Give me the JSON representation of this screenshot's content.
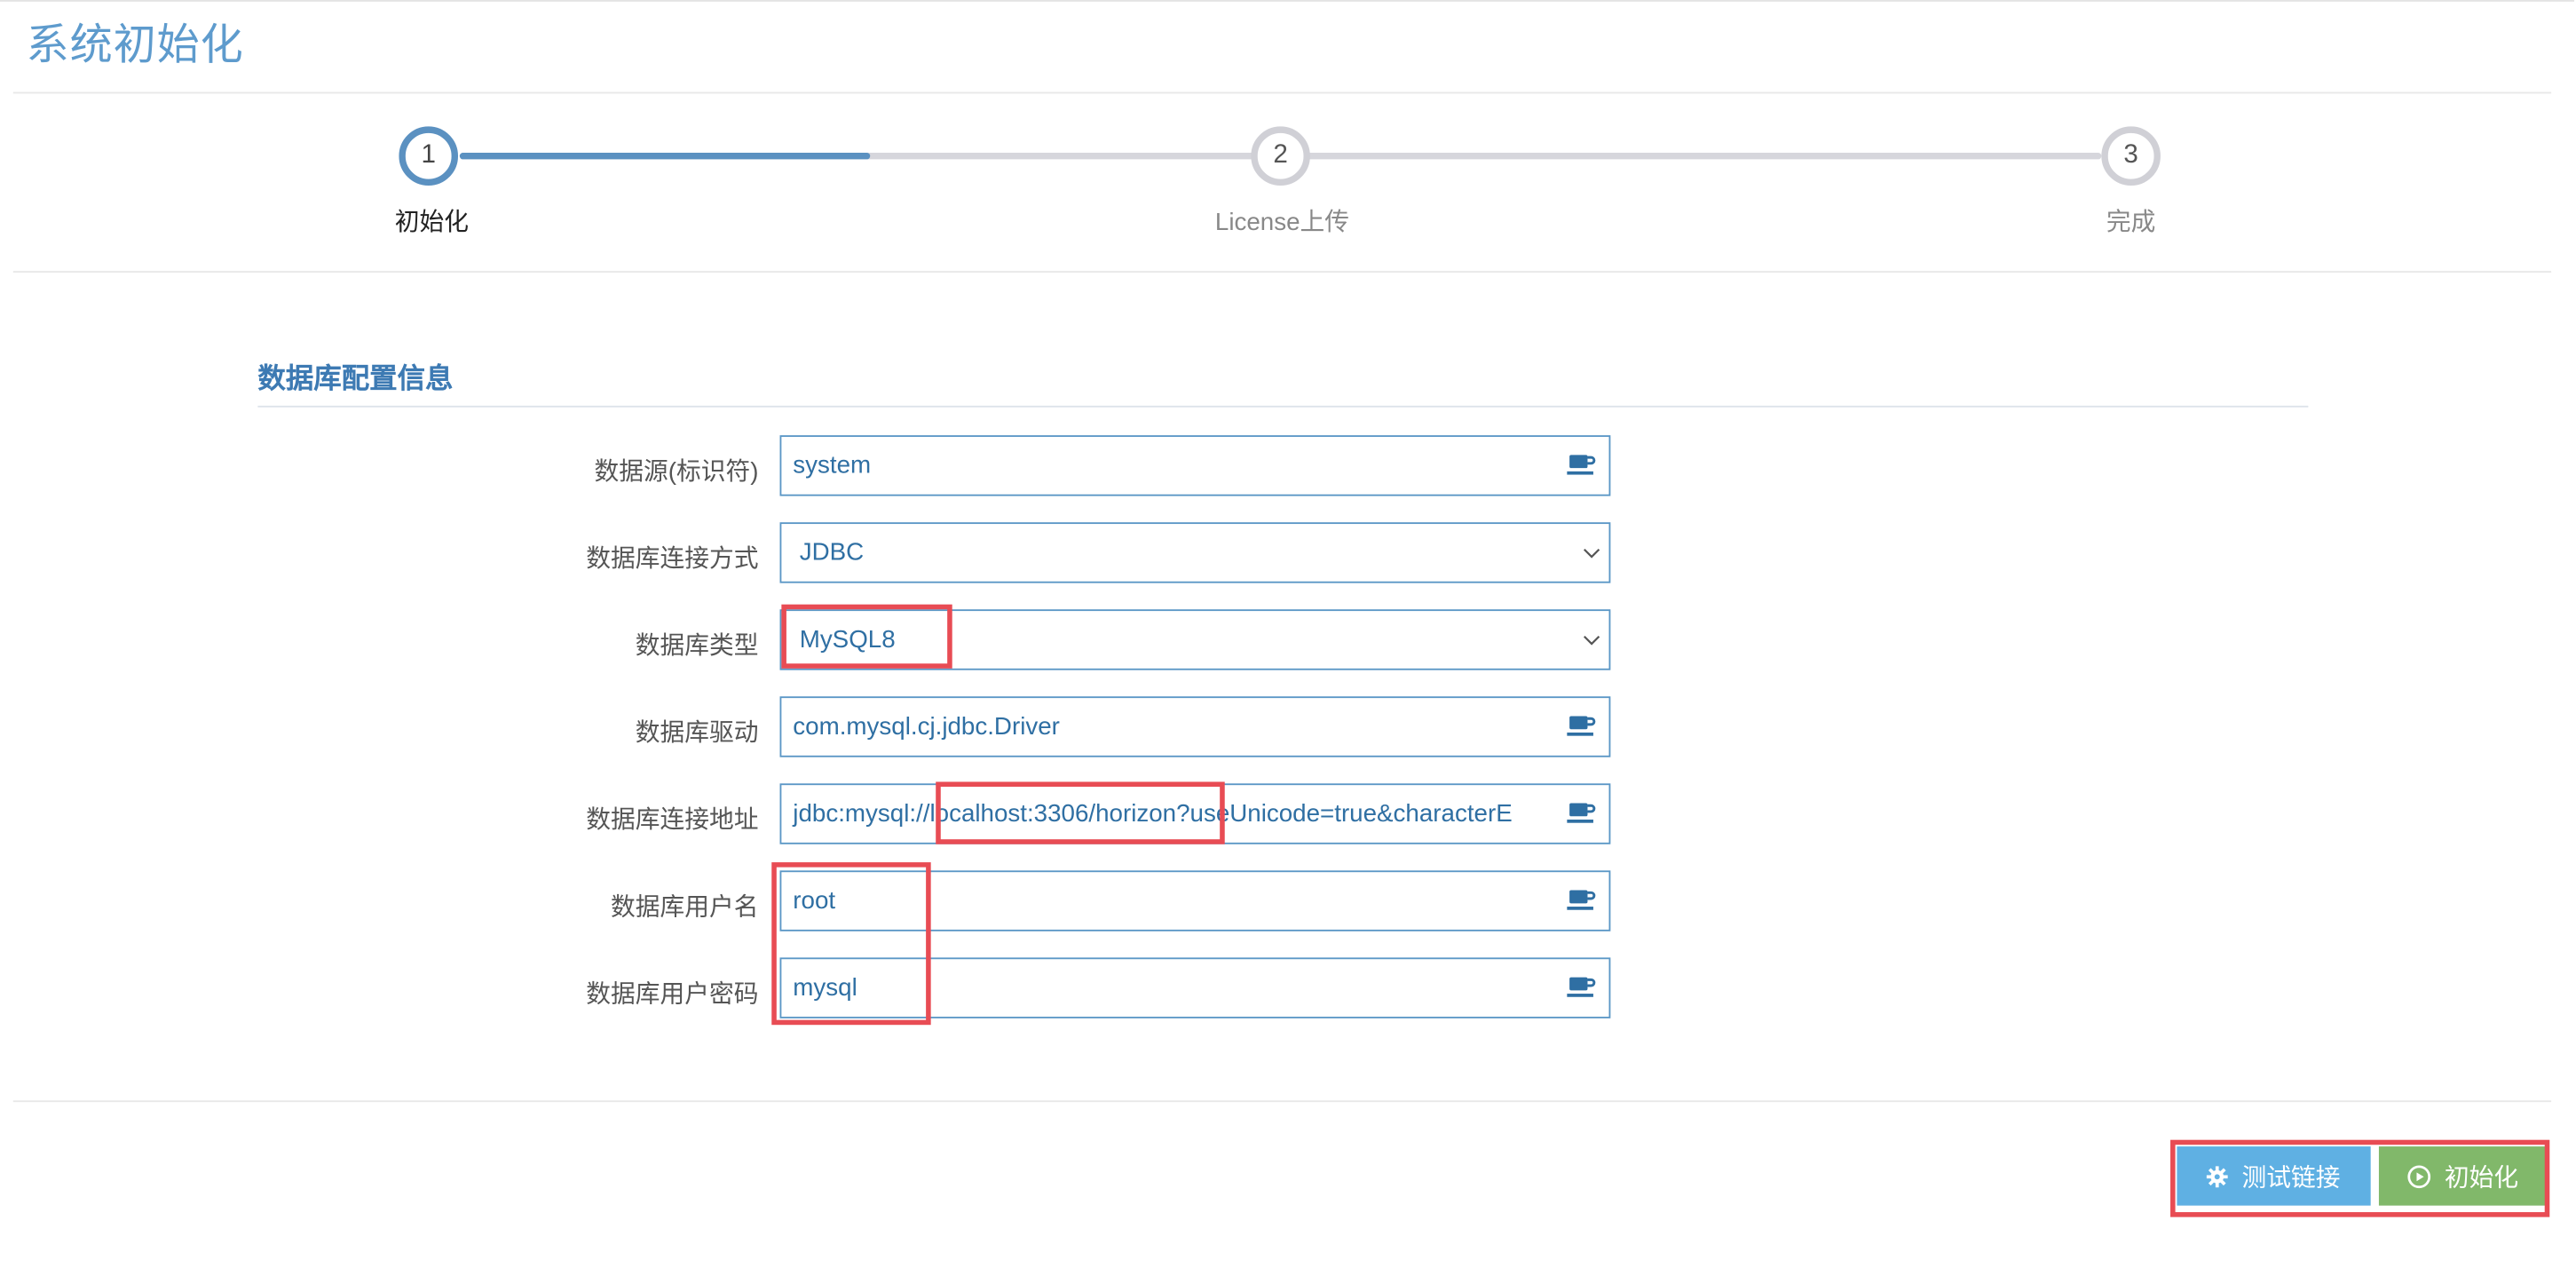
{
  "page": {
    "title": "系统初始化"
  },
  "steps": [
    {
      "number": "1",
      "label": "初始化",
      "state": "active"
    },
    {
      "number": "2",
      "label": "License上传",
      "state": "pending"
    },
    {
      "number": "3",
      "label": "完成",
      "state": "pending"
    }
  ],
  "progress": {
    "fraction": 0.25
  },
  "section": {
    "title": "数据库配置信息"
  },
  "form": {
    "datasource": {
      "label": "数据源(标识符)",
      "value": "system",
      "icon": "coffee-cup-icon"
    },
    "connection_mode": {
      "label": "数据库连接方式",
      "value": "JDBC",
      "icon": "chevron-down-icon"
    },
    "db_type": {
      "label": "数据库类型",
      "value": "MySQL8",
      "icon": "chevron-down-icon"
    },
    "driver": {
      "label": "数据库驱动",
      "value": "com.mysql.cj.jdbc.Driver",
      "icon": "coffee-cup-icon"
    },
    "url": {
      "label": "数据库连接地址",
      "value": "jdbc:mysql://localhost:3306/horizon?useUnicode=true&characterE",
      "icon": "coffee-cup-icon"
    },
    "username": {
      "label": "数据库用户名",
      "value": "root",
      "icon": "coffee-cup-icon"
    },
    "password": {
      "label": "数据库用户密码",
      "value": "mysql",
      "icon": "coffee-cup-icon"
    }
  },
  "buttons": {
    "test_connection": {
      "label": "测试链接",
      "icon": "gear-icon"
    },
    "initialize": {
      "label": "初始化",
      "icon": "play-circle-icon"
    }
  },
  "colors": {
    "accent": "#5b91c1",
    "annotation": "#e84c54",
    "test_button": "#5fb0e3",
    "init_button": "#81b86a"
  }
}
